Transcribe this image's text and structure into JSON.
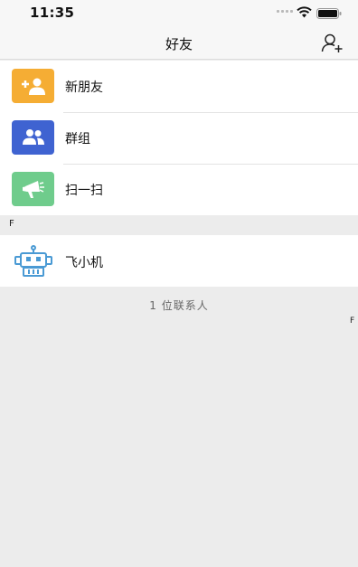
{
  "status_bar": {
    "time": "11:35"
  },
  "nav": {
    "title": "好友",
    "add_icon": "add-friend-icon"
  },
  "menu": [
    {
      "label": "新朋友",
      "icon": "new-friend-icon",
      "color": "#f5ad34"
    },
    {
      "label": "群组",
      "icon": "group-icon",
      "color": "#3f63d1"
    },
    {
      "label": "扫一扫",
      "icon": "scan-icon",
      "color": "#6fcc8c"
    }
  ],
  "section": {
    "letter": "F"
  },
  "contacts": [
    {
      "name": "飞小机",
      "avatar": "robot-avatar-icon"
    }
  ],
  "footer": {
    "count_text": "1 位联系人"
  },
  "index_bar": {
    "letters": [
      "F"
    ]
  },
  "colors": {
    "background": "#ececec",
    "robot": "#4a9ad4"
  }
}
